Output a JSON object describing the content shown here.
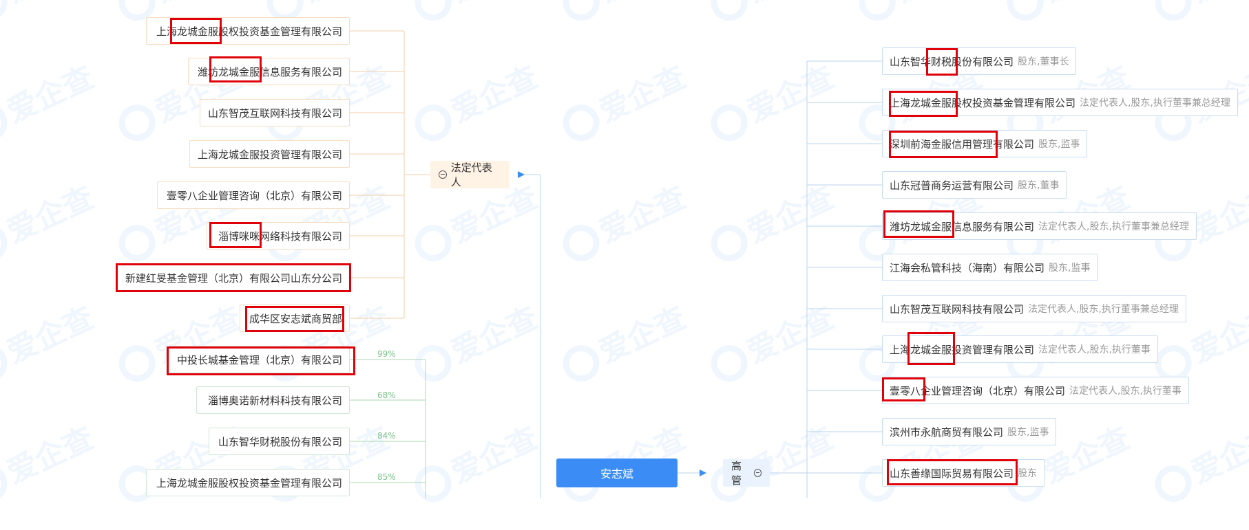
{
  "watermark_text": "爱企查",
  "center_person": "安志斌",
  "legal_rep_label": "法定代表人",
  "exec_label": "高管",
  "legal_rep_companies": [
    "上海龙城金服股权投资基金管理有限公司",
    "潍坊龙城金服信息服务有限公司",
    "山东智茂互联网科技有限公司",
    "上海龙城金服投资管理有限公司",
    "壹零八企业管理咨询（北京）有限公司",
    "淄博咪咪网络科技有限公司",
    "新建红旻基金管理（北京）有限公司山东分公司",
    "成华区安志斌商贸部"
  ],
  "shareholdings": [
    {
      "name": "中投长城基金管理（北京）有限公司",
      "pct": "99%"
    },
    {
      "name": "淄博奥诺新材料科技有限公司",
      "pct": "68%"
    },
    {
      "name": "山东智华财税股份有限公司",
      "pct": "84%"
    },
    {
      "name": "上海龙城金服股权投资基金管理有限公司",
      "pct": "85%"
    }
  ],
  "exec_positions": [
    {
      "company": "山东智华财税股份有限公司",
      "role": "股东,董事长"
    },
    {
      "company": "上海龙城金服股权投资基金管理有限公司",
      "role": "法定代表人,股东,执行董事兼总经理"
    },
    {
      "company": "深圳前海金服信用管理有限公司",
      "role": "股东,监事"
    },
    {
      "company": "山东冠普商务运营有限公司",
      "role": "股东,董事"
    },
    {
      "company": "潍坊龙城金服信息服务有限公司",
      "role": "法定代表人,股东,执行董事兼总经理"
    },
    {
      "company": "江海会私管科技（海南）有限公司",
      "role": "股东,监事"
    },
    {
      "company": "山东智茂互联网科技有限公司",
      "role": "法定代表人,股东,执行董事兼总经理"
    },
    {
      "company": "上海龙城金服投资管理有限公司",
      "role": "法定代表人,股东,执行董事"
    },
    {
      "company": "壹零八企业管理咨询（北京）有限公司",
      "role": "法定代表人,股东,执行董事"
    },
    {
      "company": "滨州市永航商贸有限公司",
      "role": "股东,监事"
    },
    {
      "company": "山东善缘国际贸易有限公司",
      "role": "股东"
    }
  ],
  "colors": {
    "center": "#3b8df5",
    "highlight": "#e0000a",
    "left_line": "#f3cfa8",
    "green_line": "#a8d9b2",
    "right_line": "#b9d3ee"
  }
}
